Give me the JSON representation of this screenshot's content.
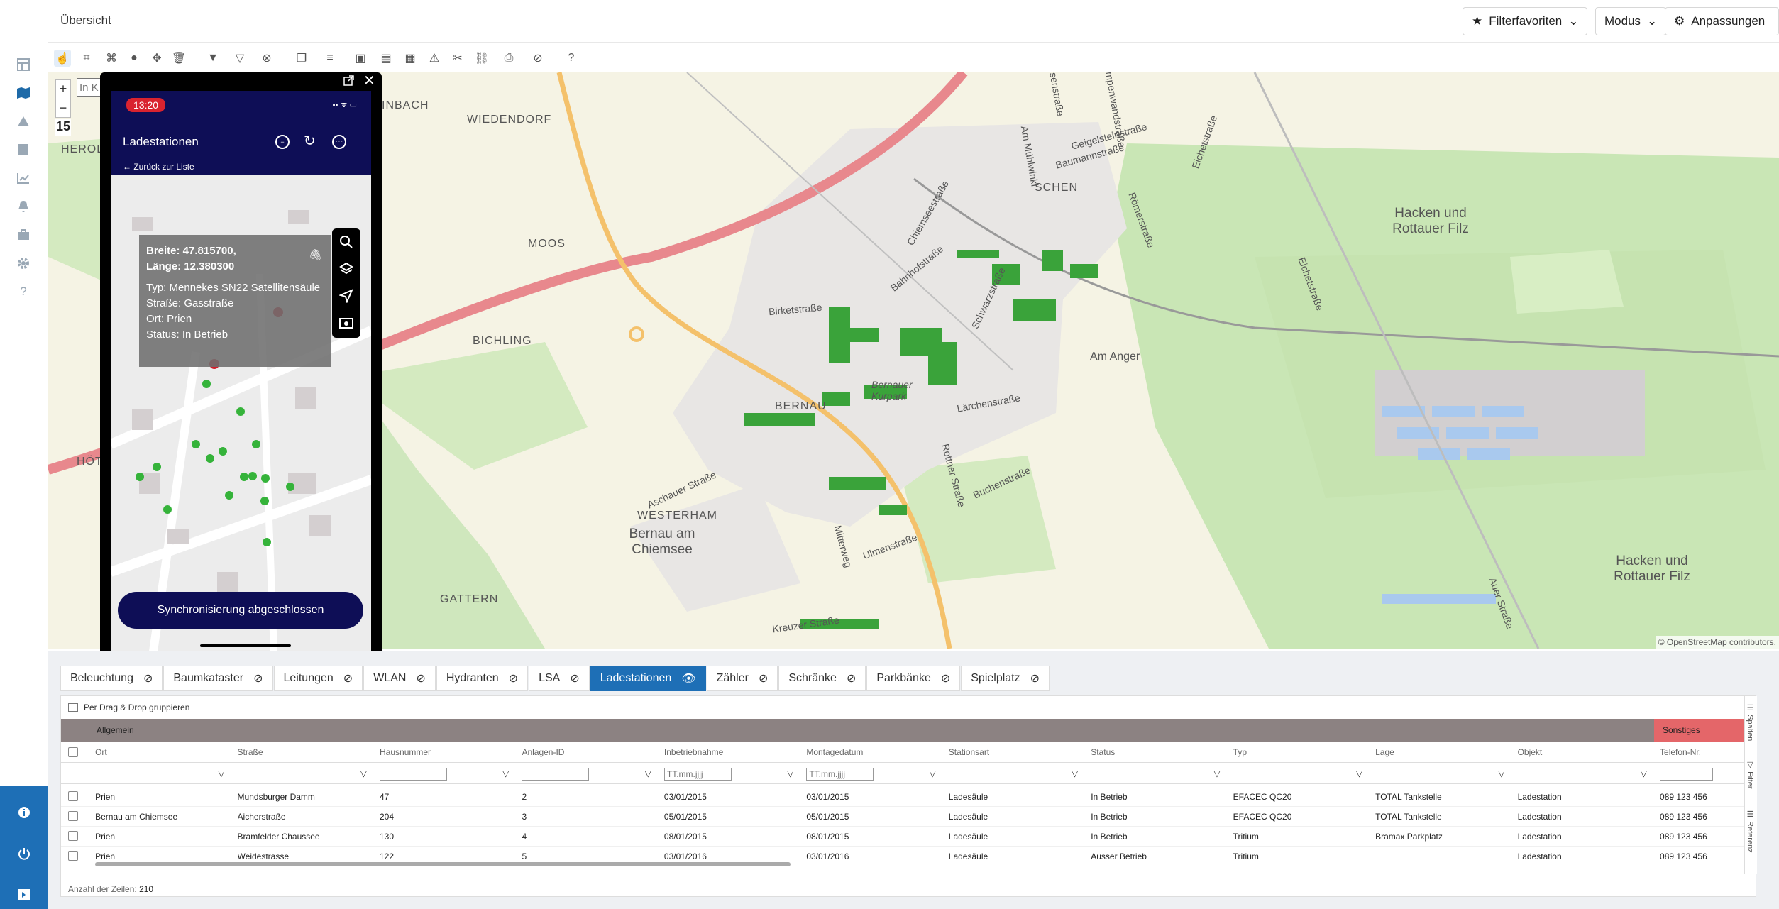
{
  "header": {
    "title": "Übersicht",
    "buttons": {
      "filterfav": "Filterfavoriten",
      "modus": "Modus",
      "anpassungen": "Anpassungen"
    }
  },
  "map": {
    "zoom_in": "+",
    "zoom_out": "−",
    "zoom_level": "15",
    "search_placeholder": "In K",
    "labels": {
      "hackenrottauer1": "Hacken und Rottauer Filz",
      "hackenrottauer2": "Hacken und Rottauer Filz",
      "bernau": "Bernau am Chiemsee",
      "moos": "MOOS",
      "bichling": "BICHLING",
      "westerham": "WESTERHAM",
      "gattern": "GATTERN",
      "wiedendorf": "WIEDENDORF",
      "inbach": "INBACH",
      "herol": "HEROL",
      "hoet": "HÖT",
      "amanger": "Am Anger",
      "bernauer_kurpark": "Bernauer Kurpark",
      "bernau_center": "BERNAU",
      "birketstr": "Birketstraße",
      "bahnhofstr": "Bahnhofstraße",
      "aschauer": "Aschauer Straße",
      "ulmenstr": "Ulmenstraße",
      "larchenstr": "Lärchenstraße",
      "buchenstr": "Buchenstraße",
      "rottener": "Rottner Straße",
      "mittenweg": "Mitterweg",
      "geigelsteinstr": "Geigelsteinstraße",
      "baumannstr": "Baumannstraße",
      "eichetstr": "Eichetstraße",
      "romerstr": "Römerstraße",
      "kampenwandstr": "Kampenwandstraße",
      "chiemseestr": "Chiemseestraße",
      "echetstr2": "Eichetstraße",
      "schwarzstr": "Schwarzstraße",
      "ammuhlwinkl": "Am Mühlwinkl",
      "kraxenstr": "Kreuzer Straße",
      "herbststr": "Rosenstraße",
      "schen": "SCHEN",
      "auerstr": "Auer Straße"
    },
    "attribution": "© OpenStreetMap contributors."
  },
  "phone": {
    "time": "13:20",
    "title": "Ladestationen",
    "back": "Zurück zur Liste",
    "popup": {
      "breite": "Breite: 47.815700,",
      "laenge": "Länge: 12.380300",
      "typ": "Typ: Mennekes SN22 Satellitensäule",
      "strasse": "Straße: Gasstraße",
      "ort": "Ort: Prien",
      "status": "Status: In Betrieb"
    },
    "sync": "Synchronisierung abgeschlossen"
  },
  "tabs": [
    "Beleuchtung",
    "Baumkataster",
    "Leitungen",
    "WLAN",
    "Hydranten",
    "LSA",
    "Ladestationen",
    "Zähler",
    "Schränke",
    "Parkbänke",
    "Spielplatz"
  ],
  "grid": {
    "group_hint": "Per Drag & Drop gruppieren",
    "section_general": "Allgemein",
    "section_other": "Sonstiges",
    "columns": [
      "Ort",
      "Straße",
      "Hausnummer",
      "Anlagen-ID",
      "Inbetriebnahme",
      "Montagedatum",
      "Stationsart",
      "Status",
      "Typ",
      "Lage",
      "Objekt",
      "Telefon-Nr."
    ],
    "date_placeholder": "TT.mm.jjjj",
    "rows": [
      [
        "Prien",
        "Mundsburger Damm",
        "47",
        "2",
        "03/01/2015",
        "03/01/2015",
        "Ladesäule",
        "In Betrieb",
        "EFACEC QC20",
        "TOTAL Tankstelle",
        "Ladestation",
        "089 123 456"
      ],
      [
        "Bernau am Chiemsee",
        "Aicherstraße",
        "204",
        "3",
        "05/01/2015",
        "05/01/2015",
        "Ladesäule",
        "In Betrieb",
        "EFACEC QC20",
        "TOTAL Tankstelle",
        "Ladestation",
        "089 123 456"
      ],
      [
        "Prien",
        "Bramfelder Chaussee",
        "130",
        "4",
        "08/01/2015",
        "08/01/2015",
        "Ladesäule",
        "In Betrieb",
        "Tritium",
        "Bramax Parkplatz",
        "Ladestation",
        "089 123 456"
      ],
      [
        "Prien",
        "Weidestrasse",
        "122",
        "5",
        "03/01/2016",
        "03/01/2016",
        "Ladesäule",
        "Ausser Betrieb",
        "Tritium",
        "",
        "Ladestation",
        "089 123 456"
      ]
    ],
    "row_count_label": "Anzahl der Zeilen:",
    "row_count": "210",
    "side_tools": [
      "Spalten",
      "Filter",
      "Referenz"
    ]
  },
  "colors": {
    "primary": "#1e6fb6",
    "phone_header": "#0e0e56",
    "sonstiges": "#e46669",
    "allgemein": "#8c8282"
  }
}
